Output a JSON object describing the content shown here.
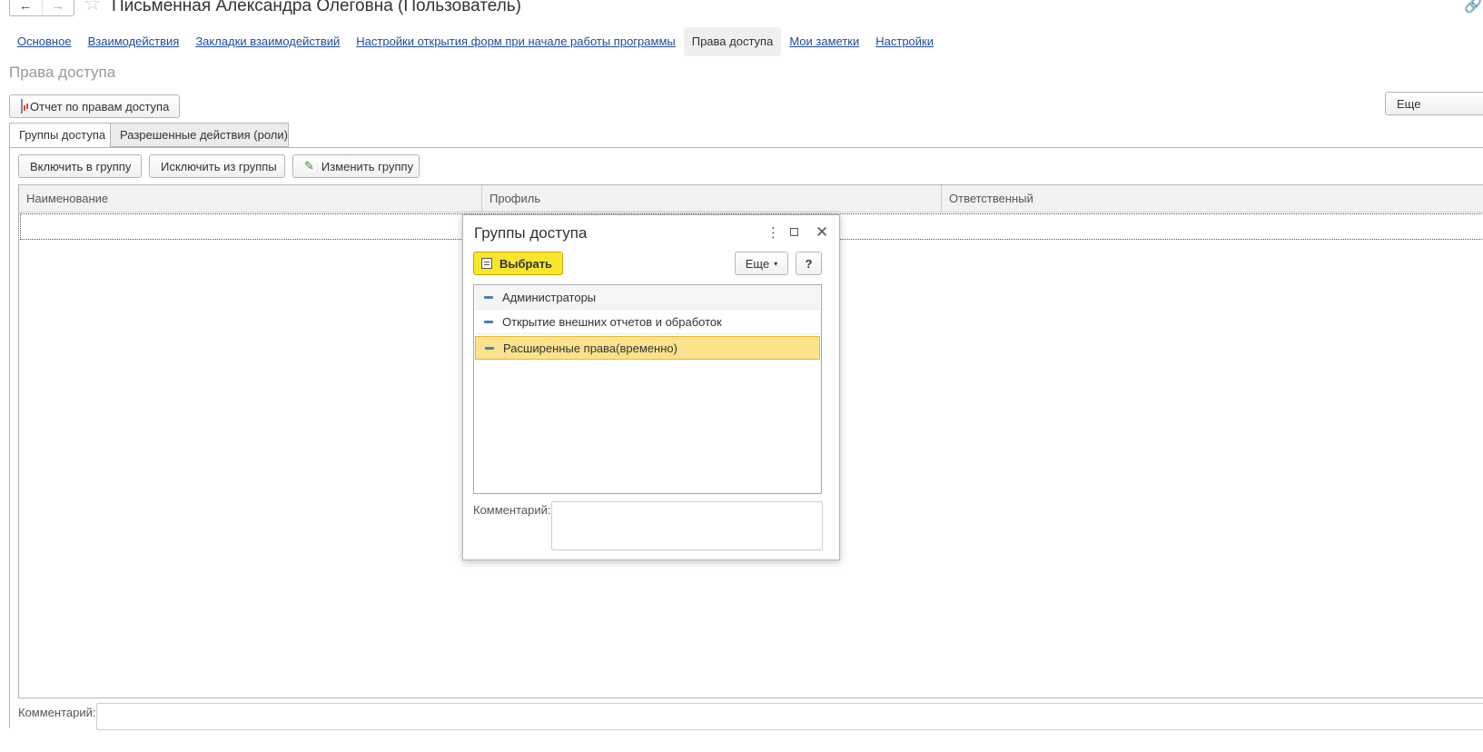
{
  "header": {
    "back_icon": "←",
    "forward_icon": "→",
    "star_icon": "☆",
    "title": "Письменная Александра Олеговна (Пользователь)",
    "link_icon": "🔗"
  },
  "nav": {
    "items": [
      {
        "label": "Основное"
      },
      {
        "label": "Взаимодействия"
      },
      {
        "label": "Закладки взаимодействий"
      },
      {
        "label": "Настройки открытия форм при начале работы программы"
      },
      {
        "label": "Права доступа"
      },
      {
        "label": "Мои заметки"
      },
      {
        "label": "Настройки"
      }
    ],
    "active": "Права доступа"
  },
  "section": {
    "title": "Права доступа",
    "report_button": "Отчет по правам доступа",
    "more_button": "Еще"
  },
  "tabs": {
    "groups": "Группы доступа",
    "roles": "Разрешенные действия (роли)"
  },
  "toolbar": {
    "include": "Включить в группу",
    "exclude": "Исключить из группы",
    "change": "Изменить группу"
  },
  "table": {
    "columns": [
      "Наименование",
      "Профиль",
      "Ответственный"
    ]
  },
  "comment": {
    "label": "Комментарий:"
  },
  "modal": {
    "title": "Группы доступа",
    "dots_icon": "⋮",
    "close_icon": "✕",
    "choose_button": "Выбрать",
    "more_button": "Еще",
    "caret": "▾",
    "help_button": "?",
    "items": [
      {
        "label": "Администраторы"
      },
      {
        "label": "Открытие внешних отчетов и обработок"
      },
      {
        "label": "Расширенные права(временно)"
      }
    ],
    "selected_index": 2,
    "comment_label": "Комментарий:"
  },
  "colors": {
    "link": "#1c4c9c",
    "choose_button": "#f7e62d",
    "selected_row": "#fbe38d"
  }
}
